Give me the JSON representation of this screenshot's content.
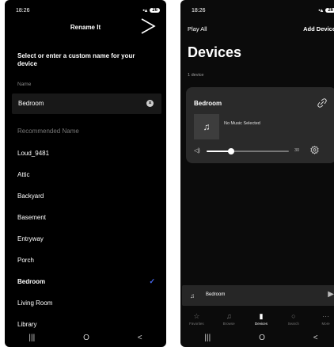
{
  "left": {
    "status": {
      "time": "18:26",
      "battery": "26"
    },
    "title": "Rename It",
    "heading": "Select or enter a custom name for your device",
    "name_label": "Name",
    "name_value": "Bedroom",
    "recommended_label": "Recommended Name",
    "options": [
      {
        "label": "Loud_9481",
        "selected": false
      },
      {
        "label": "Attic",
        "selected": false
      },
      {
        "label": "Backyard",
        "selected": false
      },
      {
        "label": "Basement",
        "selected": false
      },
      {
        "label": "Entryway",
        "selected": false
      },
      {
        "label": "Porch",
        "selected": false
      },
      {
        "label": "Bedroom",
        "selected": true
      },
      {
        "label": "Living Room",
        "selected": false
      },
      {
        "label": "Library",
        "selected": false
      }
    ],
    "nav": [
      "|||",
      "O",
      "<"
    ]
  },
  "right": {
    "status": {
      "time": "18:26",
      "battery": "26"
    },
    "play_all": "Play All",
    "add_device": "Add Device",
    "title": "Devices",
    "count": "1 device",
    "device": {
      "name": "Bedroom",
      "now_playing": "No Music Selected",
      "volume": 30
    },
    "mini_player": {
      "title": "Bedroom"
    },
    "tabs": [
      {
        "label": "Favorites",
        "icon": "star-icon",
        "glyph": "☆",
        "active": false
      },
      {
        "label": "Browse",
        "icon": "music-note-icon",
        "glyph": "♫",
        "active": false
      },
      {
        "label": "Devices",
        "icon": "speaker-icon",
        "glyph": "▮",
        "active": true
      },
      {
        "label": "Search",
        "icon": "search-icon",
        "glyph": "○",
        "active": false
      },
      {
        "label": "More",
        "icon": "more-icon",
        "glyph": "···",
        "active": false
      }
    ],
    "nav": [
      "|||",
      "O",
      "<"
    ]
  },
  "colors": {
    "accent": "#4a6cf7",
    "card": "#2a2a2a",
    "background": "#000000"
  }
}
